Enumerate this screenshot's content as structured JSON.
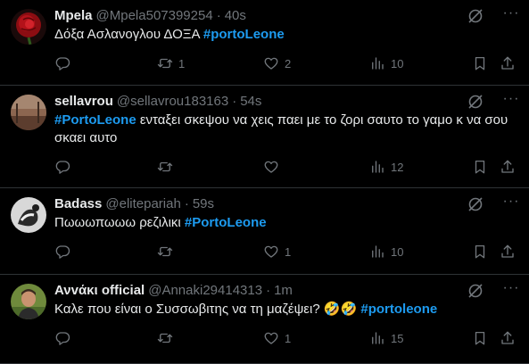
{
  "tweets": [
    {
      "name": "Μpela",
      "handle": "@Mpela507399254",
      "dot": "·",
      "time": "40s",
      "text_before": "Δόξα Ασλανογλου ΔΟΞΑ ",
      "hashtag": "#portoLeone",
      "text_after": "",
      "counts": {
        "reply": "",
        "retweet": "1",
        "like": "2",
        "views": "10"
      }
    },
    {
      "name": "sellavrou",
      "handle": "@sellavrou183163",
      "dot": "·",
      "time": "54s",
      "text_before": "",
      "hashtag": "#PortoLeone",
      "text_after": " ενταξει σκεψου να χεις παει με το ζορι σαυτο το γαμο κ να σου σκαει αυτο",
      "counts": {
        "reply": "",
        "retweet": "",
        "like": "",
        "views": "12"
      }
    },
    {
      "name": "Badass",
      "handle": "@elitepariah",
      "dot": "·",
      "time": "59s",
      "text_before": "Πωωωπωωω ρεζιλικι ",
      "hashtag": "#PortoLeone",
      "text_after": "",
      "counts": {
        "reply": "",
        "retweet": "",
        "like": "1",
        "views": "10"
      }
    },
    {
      "name": "Ανvάκι official",
      "handle": "@Annaki29414313",
      "dot": "·",
      "time": "1m",
      "text_before": "Καλε που είναι ο Συσσωβιτης να τη μαζέψει? ",
      "emoji": "🤣🤣",
      "hashtag": "#portoleone",
      "text_after": "",
      "counts": {
        "reply": "",
        "retweet": "",
        "like": "1",
        "views": "15"
      }
    }
  ],
  "icons": {
    "reply": "reply-icon",
    "retweet": "retweet-icon",
    "like": "heart-icon",
    "views": "views-icon",
    "bookmark": "bookmark-icon",
    "share": "share-icon",
    "grok": "grok-icon",
    "more": "more-icon"
  },
  "colors": {
    "background": "#000000",
    "text": "#e7e9ea",
    "muted": "#71767b",
    "accent": "#1d9bf0",
    "divider": "#2f3336"
  }
}
